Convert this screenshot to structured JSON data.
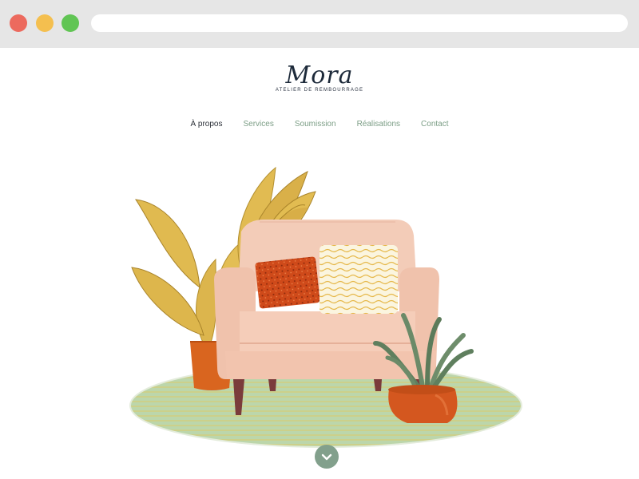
{
  "browser": {
    "traffic_lights": [
      "close",
      "minimize",
      "zoom"
    ],
    "address": ""
  },
  "logo": {
    "wordmark": "Mora",
    "tagline": "ATELIER DE REMBOURRAGE"
  },
  "nav": {
    "items": [
      {
        "label": "À propos",
        "active": true
      },
      {
        "label": "Services",
        "active": false
      },
      {
        "label": "Soumission",
        "active": false
      },
      {
        "label": "Réalisations",
        "active": false
      },
      {
        "label": "Contact",
        "active": false
      }
    ]
  },
  "colors": {
    "nav_active": "#2b3038",
    "nav_link": "#7c9e86",
    "accent_green": "#82a08c",
    "armchair": "#f2c7b3",
    "rug": "#b9d3a8",
    "pot": "#d4571f",
    "leaf": "#e0b94a"
  },
  "hero": {
    "illustration": "armchair-with-plants-illustration"
  },
  "scroll": {
    "icon": "chevron-down-icon"
  }
}
